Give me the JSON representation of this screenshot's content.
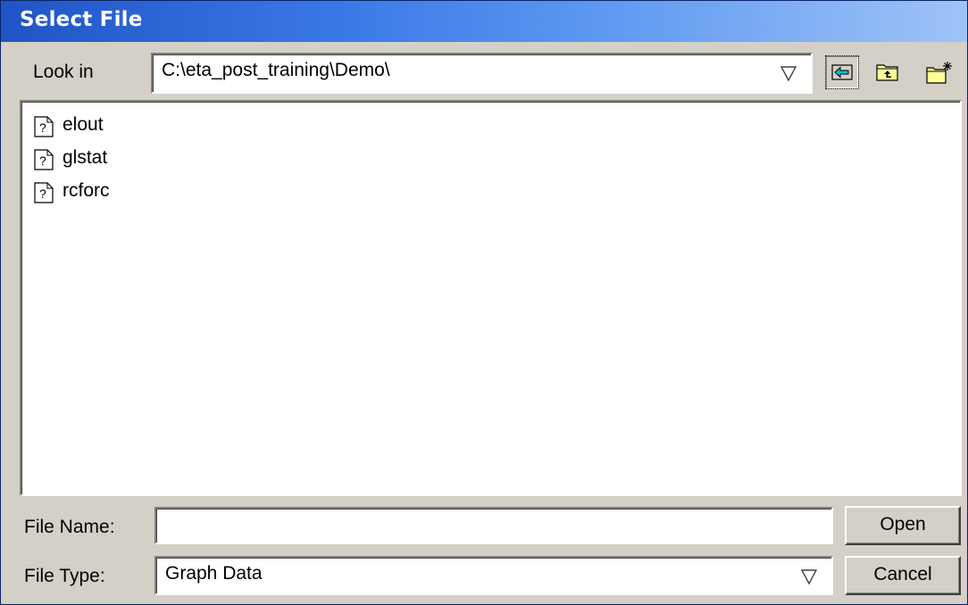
{
  "window": {
    "title": "Select File"
  },
  "look_in": {
    "label": "Look in",
    "path": "C:\\eta_post_training\\Demo\\"
  },
  "toolbar": {
    "icons": [
      "back-arrow-icon",
      "up-folder-icon",
      "new-folder-icon"
    ]
  },
  "files": [
    {
      "name": "elout",
      "icon": "unknown-file-icon"
    },
    {
      "name": "glstat",
      "icon": "unknown-file-icon"
    },
    {
      "name": "rcforc",
      "icon": "unknown-file-icon"
    }
  ],
  "file_name": {
    "label": "File Name:",
    "value": ""
  },
  "file_type": {
    "label": "File Type:",
    "value": "Graph Data"
  },
  "buttons": {
    "open": "Open",
    "cancel": "Cancel"
  },
  "colors": {
    "title_gradient_start": "#2154c6",
    "title_gradient_end": "#9fc3f7",
    "dialog_bg": "#d4d0c8",
    "back_arrow": "#00c0d0",
    "folder": "#ffff99"
  }
}
